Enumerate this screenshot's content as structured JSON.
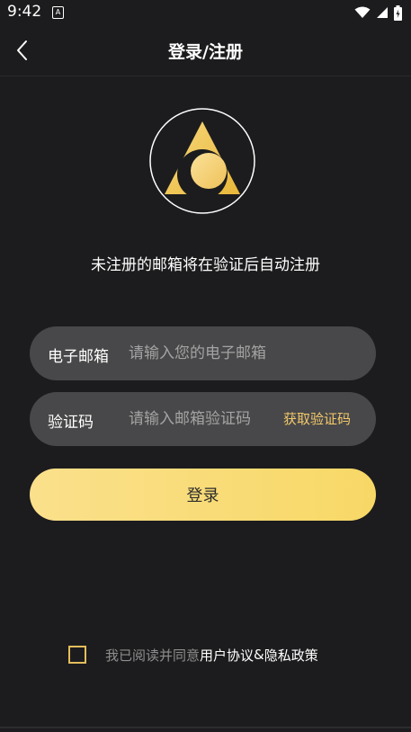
{
  "status_bar": {
    "time": "9:42",
    "app_icon_glyph": "A",
    "icons": [
      "wifi-icon",
      "signal-icon",
      "battery-icon"
    ]
  },
  "nav": {
    "title": "登录/注册",
    "back_icon": "chevron-left-icon"
  },
  "logo": {
    "icon": "triangle-crescent-logo",
    "colors": {
      "gold": "#f2c94c",
      "dark": "#1c1c1e",
      "ring": "#ffffff"
    }
  },
  "subtitle": "未注册的邮箱将在验证后自动注册",
  "email_field": {
    "label": "电子邮箱",
    "placeholder": "请输入您的电子邮箱",
    "value": ""
  },
  "code_field": {
    "label": "验证码",
    "placeholder": "请输入邮箱验证码",
    "value": "",
    "get_code_label": "获取验证码"
  },
  "login_button": {
    "label": "登录"
  },
  "agreement": {
    "checked": false,
    "prefix": "我已阅读并同意",
    "user_agreement": "用户协议",
    "amp": "&",
    "privacy_policy": "隐私政策"
  },
  "colors": {
    "background": "#1c1c1e",
    "field_bg": "#48484a",
    "accent": "#f3c96a",
    "button_gradient_start": "#fbe08c",
    "button_gradient_end": "#f7d866"
  }
}
